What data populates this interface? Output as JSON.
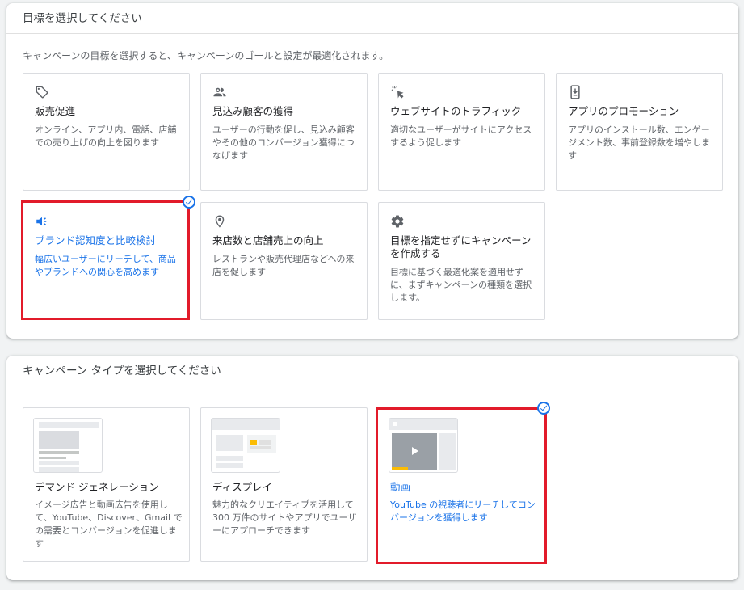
{
  "goals": {
    "header": "目標を選択してください",
    "description": "キャンペーンの目標を選択すると、キャンペーンのゴールと設定が最適化されます。",
    "cards": [
      {
        "icon": "tag-icon",
        "title": "販売促進",
        "desc": "オンライン、アプリ内、電話、店舗での売り上げの向上を図ります"
      },
      {
        "icon": "people-icon",
        "title": "見込み顧客の獲得",
        "desc": "ユーザーの行動を促し、見込み顧客やその他のコンバージョン獲得につなげます"
      },
      {
        "icon": "cursor-click-icon",
        "title": "ウェブサイトのトラフィック",
        "desc": "適切なユーザーがサイトにアクセスするよう促します"
      },
      {
        "icon": "phone-download-icon",
        "title": "アプリのプロモーション",
        "desc": "アプリのインストール数、エンゲージメント数、事前登録数を増やします"
      },
      {
        "icon": "megaphone-icon",
        "title": "ブランド認知度と比較検討",
        "desc": "幅広いユーザーにリーチして、商品やブランドへの関心を高めます",
        "selected": true
      },
      {
        "icon": "location-pin-icon",
        "title": "来店数と店舗売上の向上",
        "desc": "レストランや販売代理店などへの来店を促します"
      },
      {
        "icon": "gear-icon",
        "title": "目標を指定せずにキャンペーンを作成する",
        "desc": "目標に基づく最適化案を適用せずに、まずキャンペーンの種類を選択します。"
      }
    ]
  },
  "types": {
    "header": "キャンペーン タイプを選択してください",
    "cards": [
      {
        "icon": "demand-gen-thumbnail",
        "title": "デマンド ジェネレーション",
        "desc": "イメージ広告と動画広告を使用して、YouTube、Discover、Gmail での需要とコンバージョンを促進します"
      },
      {
        "icon": "display-thumbnail",
        "title": "ディスプレイ",
        "desc": "魅力的なクリエイティブを活用して 300 万件のサイトやアプリでユーザーにアプローチできます"
      },
      {
        "icon": "video-thumbnail",
        "title": "動画",
        "desc": "YouTube の視聴者にリーチしてコンバージョンを獲得します",
        "selected": true
      }
    ]
  },
  "colors": {
    "accent": "#1a73e8",
    "highlight": "#e21b2a"
  }
}
